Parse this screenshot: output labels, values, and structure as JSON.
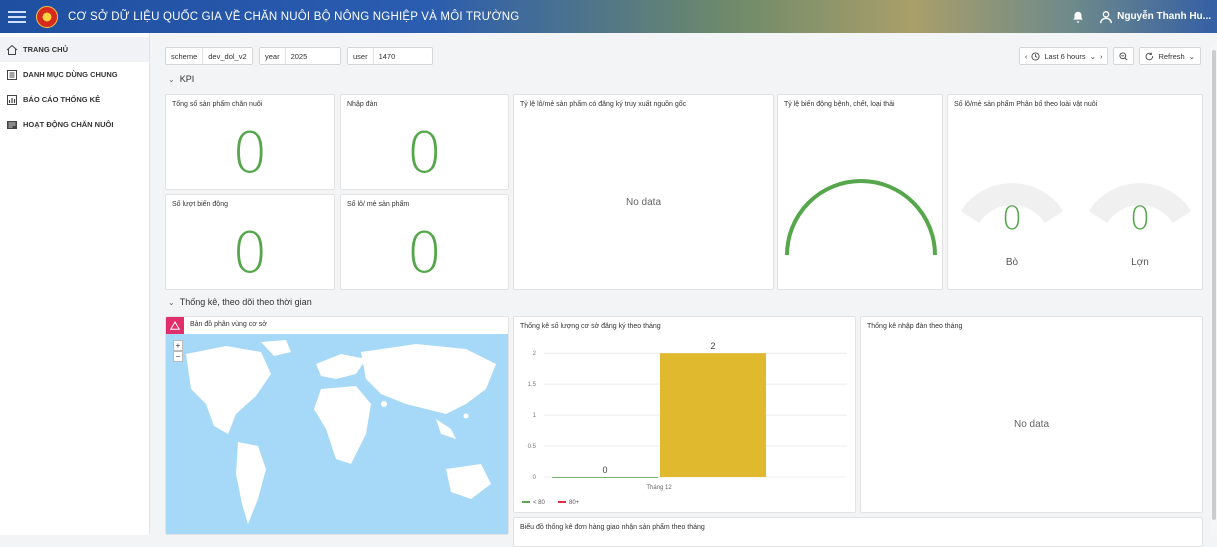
{
  "header": {
    "app_title": "CƠ SỞ DỮ LIỆU QUỐC GIA VỀ CHĂN NUÔI BỘ NÔNG NGHIỆP VÀ MÔI TRƯỜNG",
    "user_name": "Nguyễn Thanh Hu..."
  },
  "sidebar": {
    "items": [
      {
        "label": "TRANG CHỦ",
        "icon": "home-icon"
      },
      {
        "label": "DANH MỤC DÙNG CHUNG",
        "icon": "list-icon"
      },
      {
        "label": "BÁO CÁO THỐNG KÊ",
        "icon": "report-icon"
      },
      {
        "label": "HOẠT ĐỘNG CHĂN NUÔI",
        "icon": "activity-icon"
      }
    ]
  },
  "variables": [
    {
      "key": "scheme",
      "value": "dev_dol_v2"
    },
    {
      "key": "year",
      "value": "2025"
    },
    {
      "key": "user",
      "value": "1470"
    }
  ],
  "timebar": {
    "range_label": "Last 6 hours",
    "refresh_label": "Refresh"
  },
  "sections": {
    "kpi": "KPI",
    "timeline": "Thống kê, theo dõi theo thời gian"
  },
  "kpi": {
    "total_products": {
      "title": "Tổng số sản phẩm chăn nuôi",
      "value": "0"
    },
    "import_herd": {
      "title": "Nhập đàn",
      "value": "0"
    },
    "movements": {
      "title": "Số lượt biến động",
      "value": "0"
    },
    "batches": {
      "title": "Số lô/ mẻ sản phẩm",
      "value": "0"
    },
    "traceability": {
      "title": "Tỷ lệ lô/mẻ sản phẩm có đăng ký truy xuất nguồn gốc",
      "nodata": "No data"
    },
    "fluctuation_rate": {
      "title": "Tỷ lệ biến động bệnh, chết, loại thải"
    },
    "distribution": {
      "title": "Số lô/mẻ sản phẩm Phân bố theo loài vật nuôi",
      "gauges": [
        {
          "value": "0",
          "label": "Bò"
        },
        {
          "value": "0",
          "label": "Lợn"
        }
      ]
    }
  },
  "panels": {
    "map": {
      "title": "Bản đồ phân vùng cơ sở",
      "zoom_in": "+",
      "zoom_out": "−"
    },
    "registrations": {
      "title": "Thống kê số lượng cơ sở đăng ký theo tháng"
    },
    "import_monthly": {
      "title": "Thống kê nhập đàn theo tháng",
      "nodata": "No data"
    },
    "orders": {
      "title": "Biểu đồ thống kê đơn hàng giao nhận sản phẩm theo tháng"
    }
  },
  "chart_data": {
    "type": "bar",
    "title": "Thống kê số lượng cơ sở đăng ký theo tháng",
    "categories": [
      "Tháng 12"
    ],
    "series": [
      {
        "name": "< 80",
        "values": [
          0
        ],
        "color": "#56a64b"
      },
      {
        "name": "80+",
        "values": [
          2
        ],
        "color": "#e0b92f"
      }
    ],
    "yticks": [
      "0",
      "0.5",
      "1",
      "1.5",
      "2"
    ],
    "ylim": [
      0,
      2.1
    ],
    "legend_colors": [
      "#56a64b",
      "#e02f44"
    ]
  },
  "colors": {
    "stat_green": "#56a64b",
    "bar_yellow": "#e0b92f",
    "alert_pink": "#e02f6a"
  }
}
